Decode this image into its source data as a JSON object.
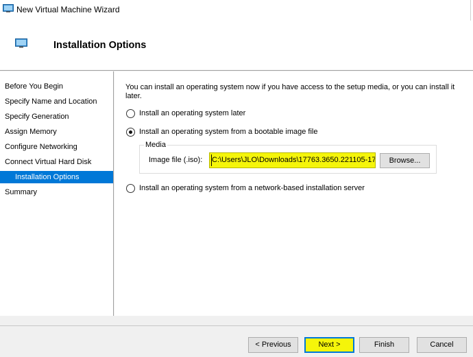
{
  "window": {
    "title": "New Virtual Machine Wizard"
  },
  "header": {
    "title": "Installation Options"
  },
  "nav": {
    "items": [
      {
        "label": "Before You Begin"
      },
      {
        "label": "Specify Name and Location"
      },
      {
        "label": "Specify Generation"
      },
      {
        "label": "Assign Memory"
      },
      {
        "label": "Configure Networking"
      },
      {
        "label": "Connect Virtual Hard Disk"
      },
      {
        "label": "Installation Options"
      },
      {
        "label": "Summary"
      }
    ],
    "selected": "Installation Options"
  },
  "content": {
    "intro": "You can install an operating system now if you have access to the setup media, or you can install it later.",
    "options": [
      {
        "label": "Install an operating system later",
        "checked": false
      },
      {
        "label": "Install an operating system from a bootable image file",
        "checked": true
      },
      {
        "label": "Install an operating system from a network-based installation server",
        "checked": false
      }
    ],
    "media": {
      "legend": "Media",
      "image_label": "Image file (.iso):",
      "image_value": "C:\\Users\\JLO\\Downloads\\17763.3650.221105-17",
      "browse_label": "Browse..."
    }
  },
  "buttons": {
    "previous": "< Previous",
    "next": "Next >",
    "finish": "Finish",
    "cancel": "Cancel"
  },
  "colors": {
    "accent": "#0078d7",
    "highlight": "#f5f50a"
  }
}
